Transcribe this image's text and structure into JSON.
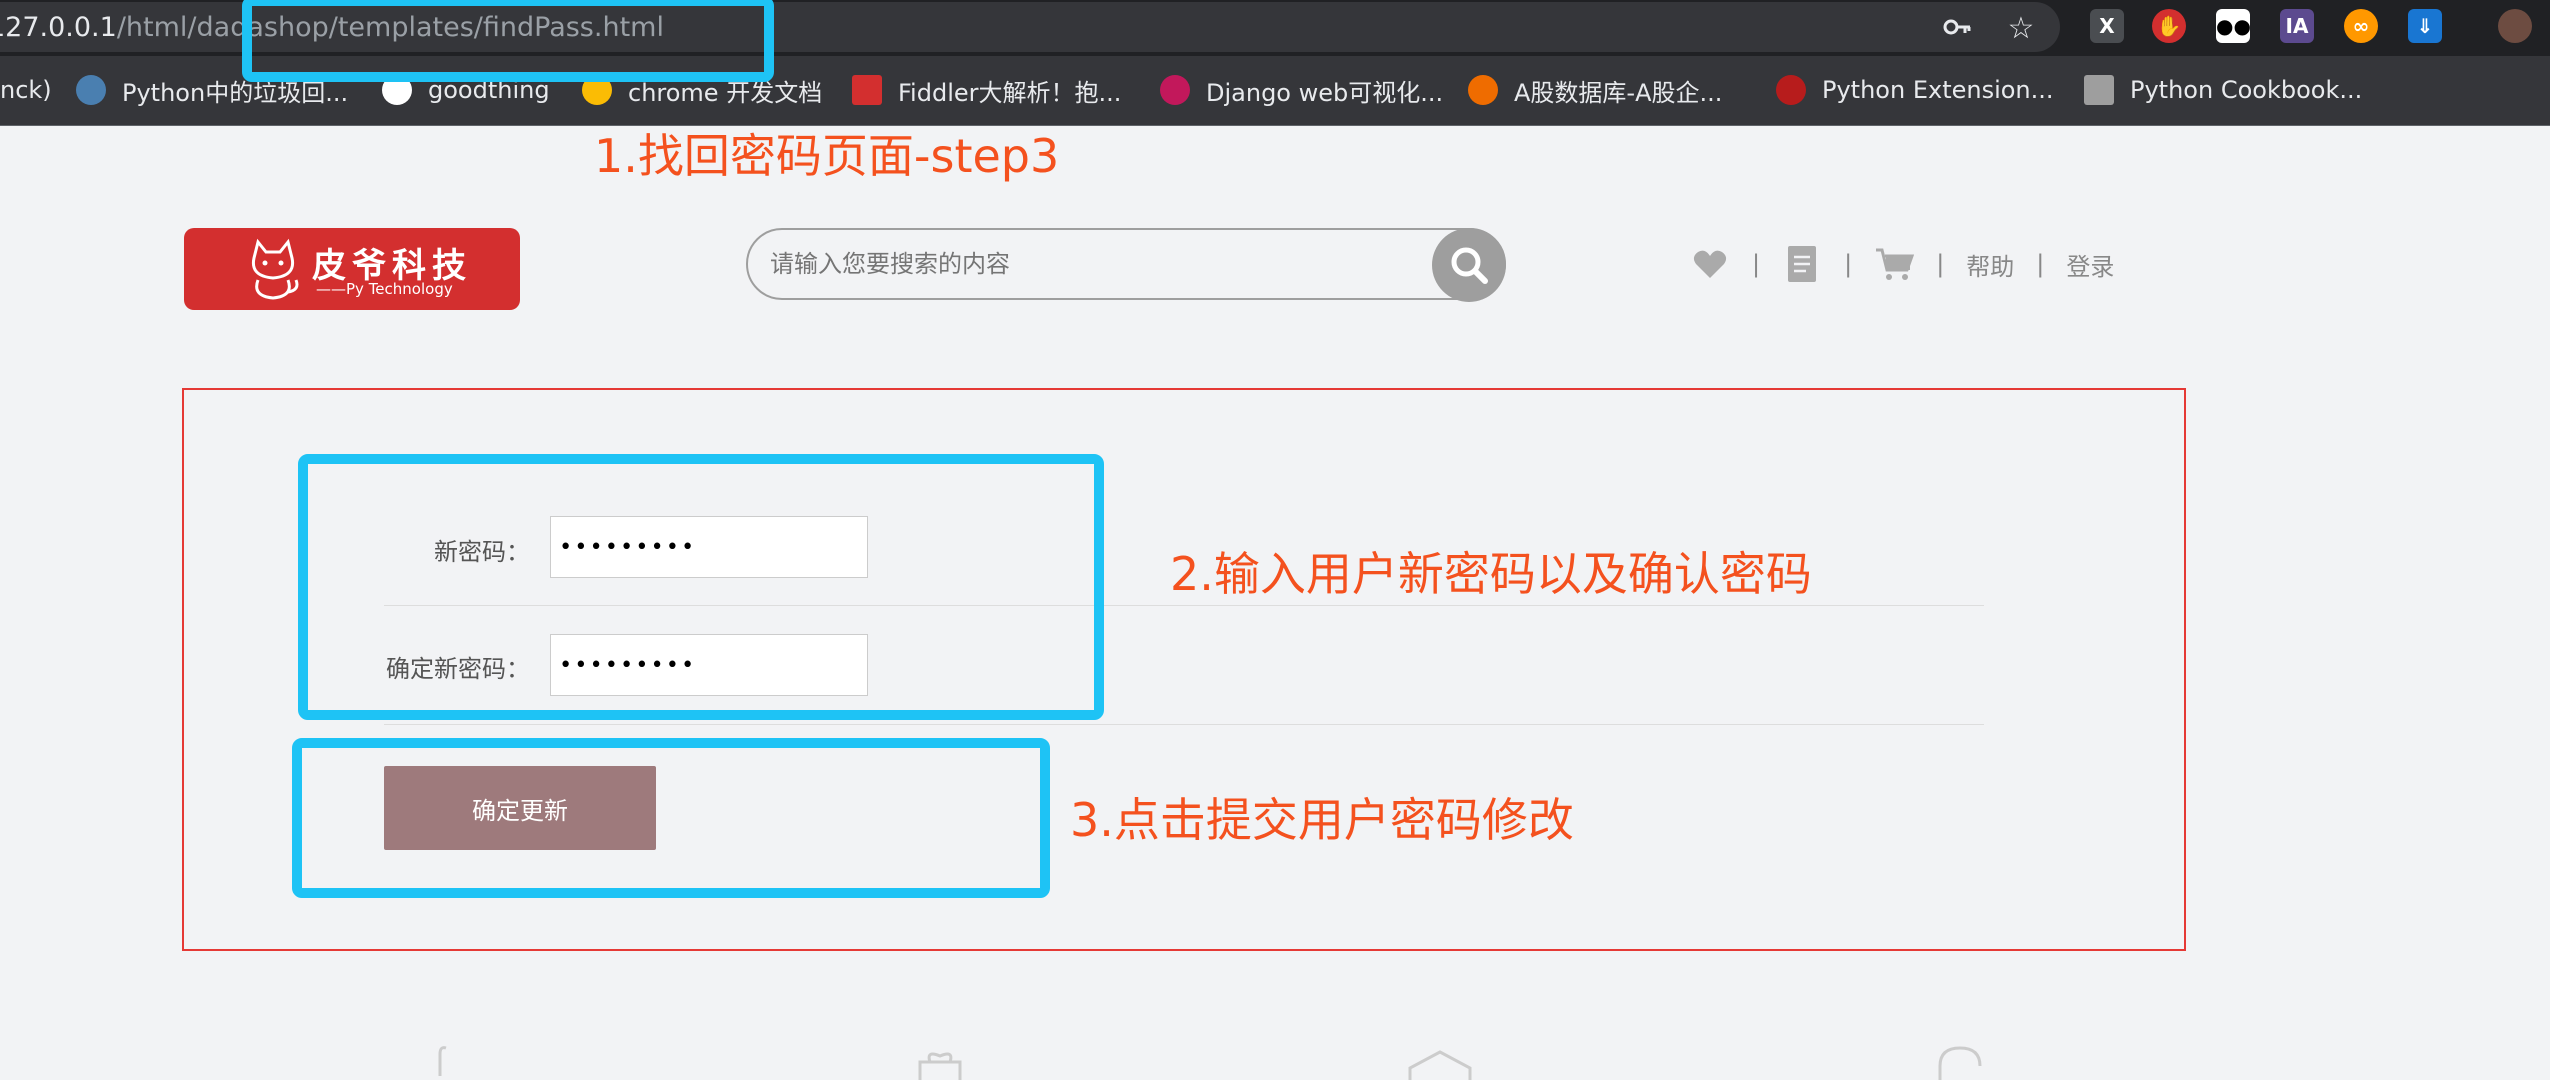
{
  "browser": {
    "url_host": "127.0.0.1",
    "url_path": "/html/dadashop/templates/findPass.html",
    "bookmarks": [
      {
        "label": "nck)"
      },
      {
        "label": "Python中的垃圾回..."
      },
      {
        "label": "goodthing"
      },
      {
        "label": "chrome 开发文档"
      },
      {
        "label": "Fiddler大解析！抱..."
      },
      {
        "label": "Django web可视化..."
      },
      {
        "label": "A股数据库-A股企..."
      },
      {
        "label": "Python Extension..."
      },
      {
        "label": "Python Cookbook..."
      }
    ],
    "extension_ia_label": "IA"
  },
  "annotations": {
    "step1": "1.找回密码页面-step3",
    "step2": "2.输入用户新密码以及确认密码",
    "step3": "3.点击提交用户密码修改",
    "color": "#f4511e",
    "box_color": "#1ec3f5"
  },
  "header": {
    "logo_brand": "皮爷科技",
    "logo_sub": "——Py Technology",
    "search_placeholder": "请输入您要搜索的内容",
    "nav": {
      "help": "帮助",
      "login": "登录",
      "sep": "|"
    }
  },
  "form": {
    "new_password_label": "新密码：",
    "new_password_value": "•••••••••",
    "confirm_password_label": "确定新密码：",
    "confirm_password_value": "•••••••••",
    "submit_label": "确定更新",
    "panel_border_color": "#e53935",
    "button_color": "#9e7a7c"
  }
}
